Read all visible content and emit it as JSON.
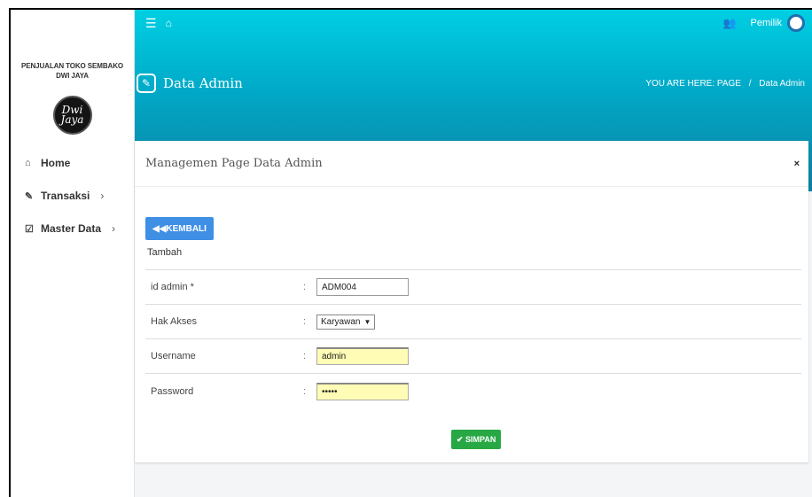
{
  "sidebar": {
    "brand_line1": "PENJUALAN TOKO SEMBAKO",
    "brand_line2": "DWI JAYA",
    "logo_text": "Dwi Jaya",
    "items": [
      {
        "label": "Home",
        "icon": "home-icon",
        "glyph": "⌂",
        "has_children": false
      },
      {
        "label": "Transaksi",
        "icon": "pencil-icon",
        "glyph": "✎",
        "has_children": true
      },
      {
        "label": "Master Data",
        "icon": "edit-icon",
        "glyph": "☑",
        "has_children": true
      }
    ]
  },
  "topnav": {
    "menu_glyph": "☰",
    "home_glyph": "⌂",
    "users_glyph": "👥",
    "user_name": "Pemilik"
  },
  "header": {
    "title": "Data Admin",
    "breadcrumb_prefix": "YOU ARE HERE:",
    "breadcrumb_page": "PAGE",
    "breadcrumb_sep": "/",
    "breadcrumb_current": "Data Admin"
  },
  "card": {
    "title": "Managemen Page Data Admin",
    "close_glyph": "×",
    "back_label": "◀◀KEMBALI",
    "section": "Tambah",
    "colon": ":",
    "fields": {
      "id_admin": {
        "label": "id admin *",
        "value": "ADM004"
      },
      "hak_akses": {
        "label": "Hak Akses",
        "value": "Karyawan",
        "arrow": "▼"
      },
      "username": {
        "label": "Username",
        "value": "admin"
      },
      "password": {
        "label": "Password",
        "value": "•••••"
      }
    },
    "save_label": "✔ SIMPAN"
  },
  "colors": {
    "header_top": "#00cfe3",
    "header_bottom": "#0f7fa1",
    "back_button": "#3f8fe5",
    "save_button": "#28a745"
  }
}
